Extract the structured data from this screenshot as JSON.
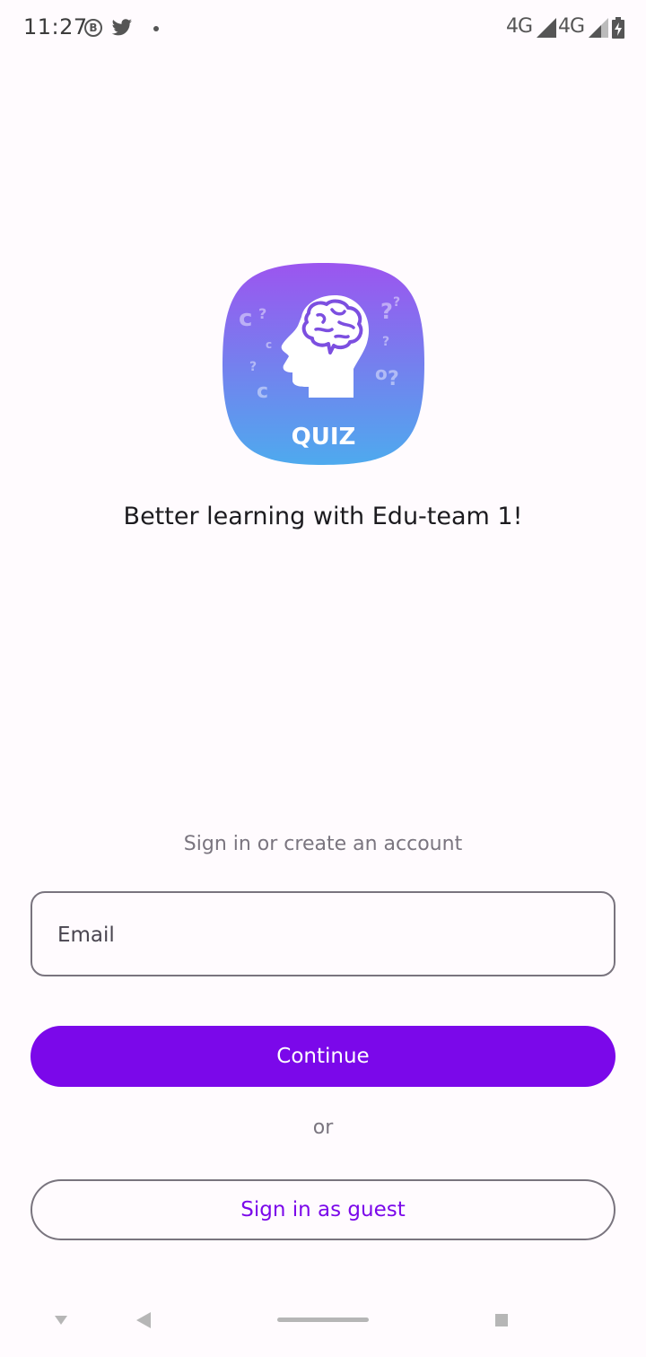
{
  "status_bar": {
    "time": "11:27",
    "b_badge": "B",
    "icons": [
      "b-badge-icon",
      "twitter-icon",
      "notification-dot-icon"
    ],
    "network_1": "4G",
    "network_2": "4G",
    "right_icons": [
      "signal-icon",
      "signal-icon",
      "battery-charging-icon"
    ]
  },
  "logo": {
    "label": "QUIZ",
    "gradient_top": "#9b59f0",
    "gradient_bottom": "#4fa8ee"
  },
  "tagline": "Better learning with Edu-team 1!",
  "auth": {
    "hint": "Sign in or create an account",
    "email_placeholder": "Email",
    "continue_label": "Continue",
    "or_label": "or",
    "guest_label": "Sign in as guest"
  },
  "colors": {
    "accent": "#7b08ea",
    "background": "#fffbfe",
    "outline": "#79747e"
  },
  "nav_bar": {
    "icons": [
      "nav-down-icon",
      "back-icon",
      "home-pill",
      "recents-icon"
    ]
  }
}
